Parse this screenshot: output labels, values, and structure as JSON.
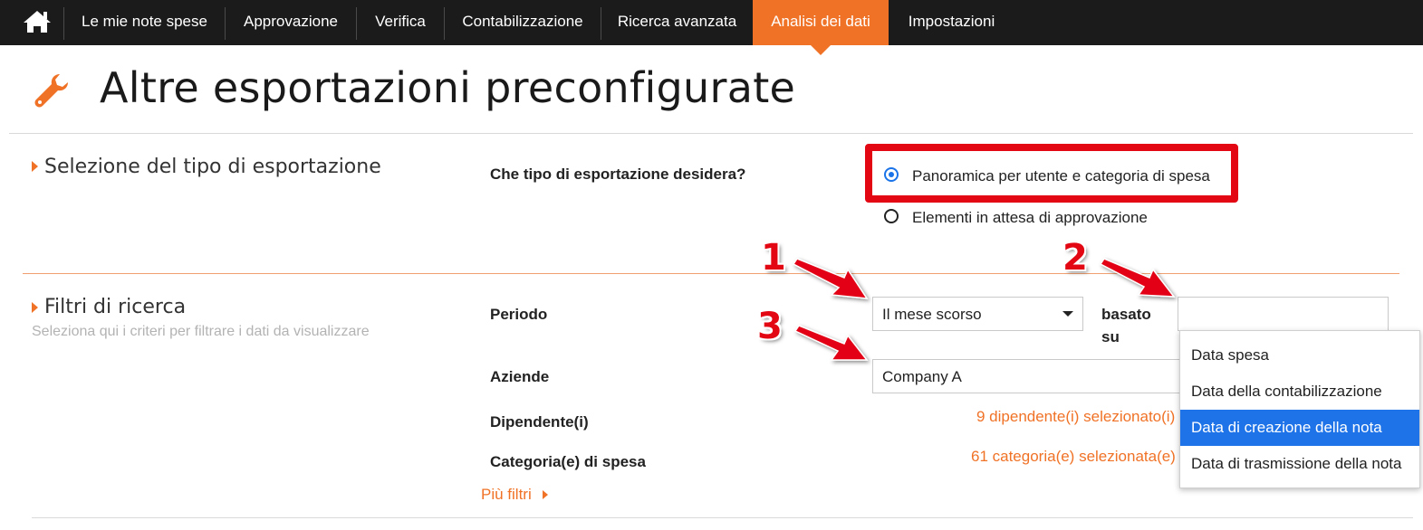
{
  "nav": {
    "home_icon": "home-icon",
    "items": [
      {
        "label": "Le mie note spese"
      },
      {
        "label": "Approvazione"
      },
      {
        "label": "Verifica"
      },
      {
        "label": "Contabilizzazione"
      },
      {
        "label": "Ricerca avanzata"
      },
      {
        "label": "Analisi dei dati",
        "active": true
      },
      {
        "label": "Impostazioni"
      }
    ]
  },
  "colors": {
    "accent": "#f07226",
    "nav_bg": "#1b1b1b",
    "annotation": "#e30613",
    "selection": "#1e73e8"
  },
  "page": {
    "title": "Altre esportazioni preconfigurate",
    "icon": "wrench-icon"
  },
  "export_section": {
    "title": "Selezione del tipo di esportazione",
    "question": "Che tipo di esportazione desidera?",
    "options": [
      {
        "label": "Panoramica per utente e categoria di spesa",
        "checked": true
      },
      {
        "label": "Elementi in attesa di approvazione",
        "checked": false
      }
    ]
  },
  "filters_section": {
    "title": "Filtri di ricerca",
    "subtitle": "Seleziona qui i criteri per filtrare i dati da visualizzare",
    "period_label": "Periodo",
    "period_value": "Il mese scorso",
    "based_on_label_1": "basato",
    "based_on_label_2": "su",
    "based_on_value": "",
    "companies_label": "Aziende",
    "companies_value": "Company A",
    "employees_label": "Dipendente(i)",
    "employees_value": "9 dipendente(i) selezionato(i)",
    "categories_label": "Categoria(e) di spesa",
    "categories_value": "61 categoria(e) selezionata(e)",
    "more_filters": "Più filtri"
  },
  "based_on_dropdown": {
    "options": [
      {
        "label": "Data spesa",
        "selected": false
      },
      {
        "label": "Data della contabilizzazione",
        "selected": false
      },
      {
        "label": "Data di creazione della nota",
        "selected": true
      },
      {
        "label": "Data di trasmissione della nota",
        "selected": false
      }
    ]
  },
  "annotations": [
    "1",
    "2",
    "3"
  ]
}
